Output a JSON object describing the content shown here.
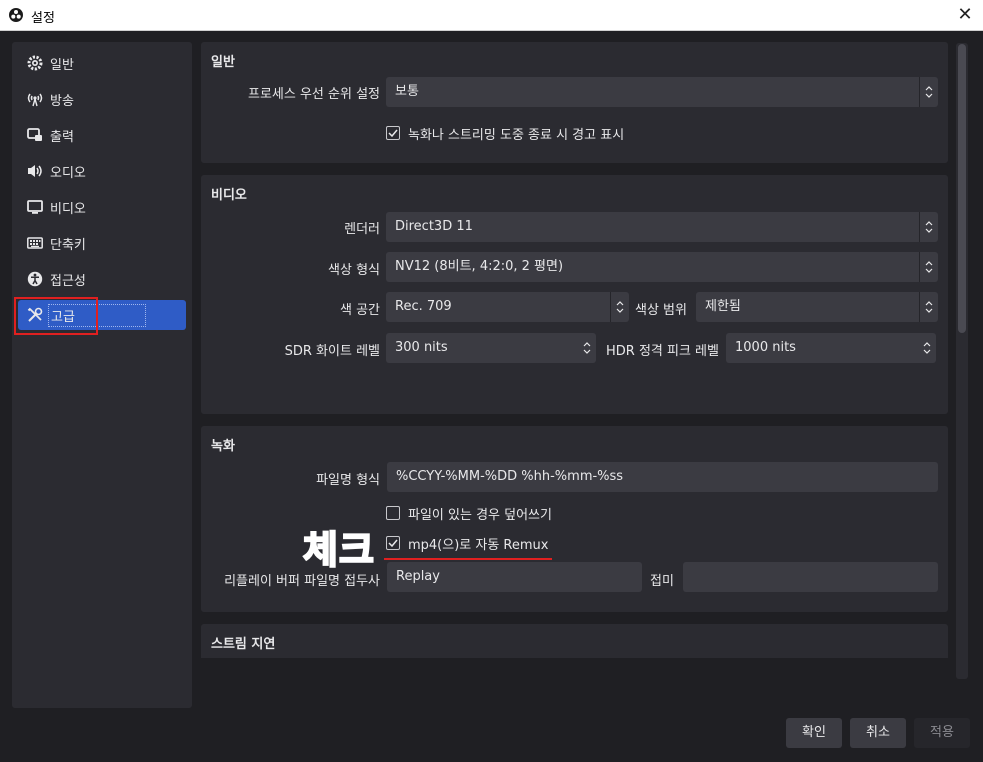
{
  "window": {
    "title": "설정",
    "close_glyph": "✕"
  },
  "sidebar": {
    "items": [
      {
        "label": "일반",
        "icon": "gear-icon"
      },
      {
        "label": "방송",
        "icon": "broadcast-icon"
      },
      {
        "label": "출력",
        "icon": "output-icon"
      },
      {
        "label": "오디오",
        "icon": "speaker-icon"
      },
      {
        "label": "비디오",
        "icon": "monitor-icon"
      },
      {
        "label": "단축키",
        "icon": "keyboard-icon"
      },
      {
        "label": "접근성",
        "icon": "accessibility-icon"
      },
      {
        "label": "고급",
        "icon": "tools-icon",
        "active": true
      }
    ]
  },
  "general": {
    "title": "일반",
    "priority_label": "프로세스 우선 순위 설정",
    "priority_value": "보통",
    "warn_checkbox": {
      "label": "녹화나 스트리밍 도중 종료 시 경고 표시",
      "checked": true
    }
  },
  "video": {
    "title": "비디오",
    "renderer_label": "렌더러",
    "renderer_value": "Direct3D 11",
    "color_format_label": "색상 형식",
    "color_format_value": "NV12 (8비트, 4:2:0, 2 평면)",
    "color_space_label": "색 공간",
    "color_space_value": "Rec. 709",
    "color_range_label": "색상 범위",
    "color_range_value": "제한됨",
    "sdr_label": "SDR 화이트 레벨",
    "sdr_value": "300 nits",
    "hdr_label": "HDR 정격 피크 레벨",
    "hdr_value": "1000 nits"
  },
  "recording": {
    "title": "녹화",
    "filename_label": "파일명 형식",
    "filename_value": "%CCYY-%MM-%DD %hh-%mm-%ss",
    "overwrite_checkbox": {
      "label": "파일이 있는 경우 덮어쓰기",
      "checked": false
    },
    "remux_checkbox": {
      "label": "mp4(으)로 자동 Remux",
      "checked": true
    },
    "replay_prefix_label": "리플레이 버퍼 파일명 접두사",
    "replay_prefix_value": "Replay",
    "suffix_label": "접미",
    "suffix_value": ""
  },
  "stream_delay": {
    "title": "스트림 지연"
  },
  "annotation": {
    "text": "체크"
  },
  "buttons": {
    "ok": "확인",
    "cancel": "취소",
    "apply": "적용"
  },
  "colors": {
    "accent": "#2f5cc6",
    "panel": "#2b2b31",
    "background": "#1f1f23",
    "highlight_red": "#e02020"
  }
}
